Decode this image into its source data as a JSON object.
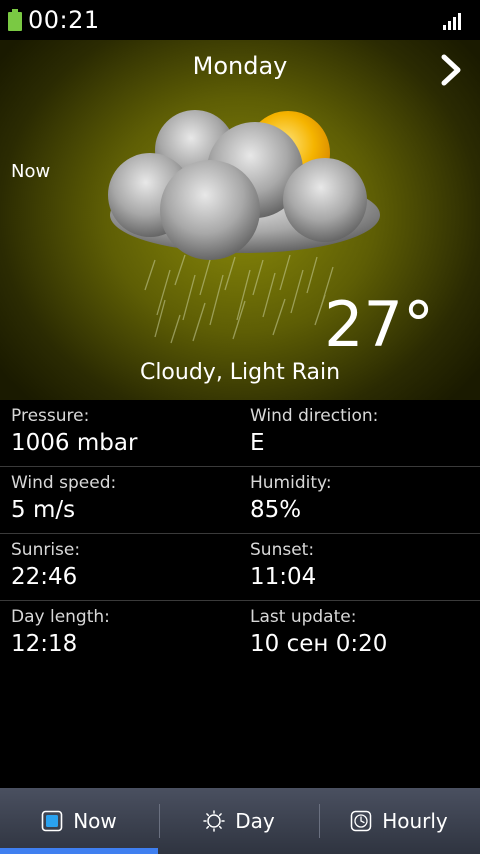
{
  "status_bar": {
    "time": "00:21",
    "battery_icon": "battery-icon",
    "signal_icon": "signal-icon",
    "battery_color": "#7ac943"
  },
  "hero": {
    "day": "Monday",
    "now_label": "Now",
    "temperature": "27°",
    "condition": "Cloudy, Light Rain",
    "weather_icon": "cloudy-rain-sun-icon",
    "next_icon": "chevron-right-icon",
    "background_color": "#6a6a06"
  },
  "details": {
    "rows": [
      {
        "left": {
          "label": "Pressure:",
          "value": "1006 mbar"
        },
        "right": {
          "label": "Wind direction:",
          "value": "E"
        }
      },
      {
        "left": {
          "label": "Wind speed:",
          "value": "5 m/s"
        },
        "right": {
          "label": "Humidity:",
          "value": "85%"
        }
      },
      {
        "left": {
          "label": "Sunrise:",
          "value": "22:46"
        },
        "right": {
          "label": "Sunset:",
          "value": "11:04"
        }
      },
      {
        "left": {
          "label": "Day length:",
          "value": "12:18"
        },
        "right": {
          "label": "Last update:",
          "value": "10 сен 0:20"
        }
      }
    ]
  },
  "tabs": [
    {
      "label": "Now",
      "icon": "square-icon",
      "selected": true
    },
    {
      "label": "Day",
      "icon": "sun-outline-icon",
      "selected": false
    },
    {
      "label": "Hourly",
      "icon": "clock-icon",
      "selected": false
    }
  ],
  "accent_color": "#3f7ff0"
}
